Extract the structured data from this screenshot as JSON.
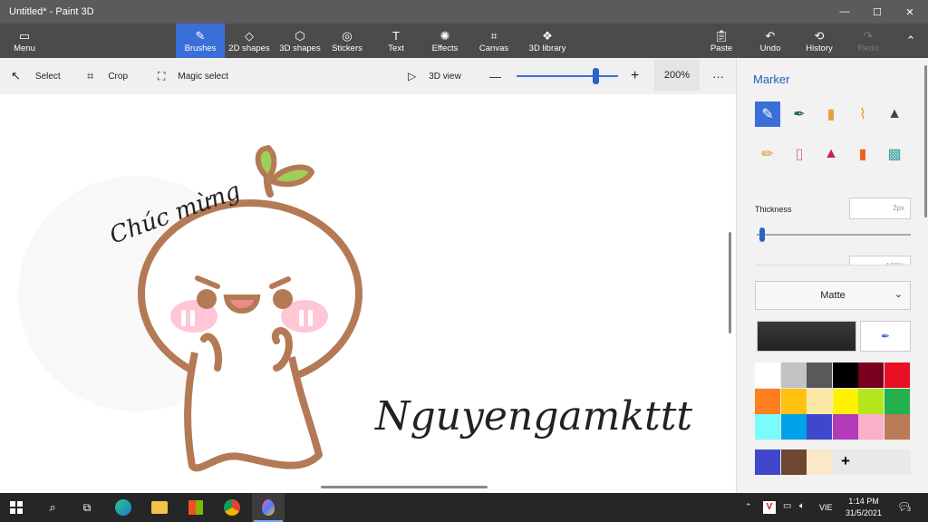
{
  "window": {
    "title": "Untitled* - Paint 3D",
    "min": "—",
    "max": "☐",
    "close": "✕"
  },
  "ribbon": {
    "menu": "Menu",
    "tools": [
      {
        "label": "Brushes",
        "icon": "✎"
      },
      {
        "label": "2D shapes",
        "icon": "◇"
      },
      {
        "label": "3D shapes",
        "icon": "⬡"
      },
      {
        "label": "Stickers",
        "icon": "◎"
      },
      {
        "label": "Text",
        "icon": "T"
      },
      {
        "label": "Effects",
        "icon": "✺"
      },
      {
        "label": "Canvas",
        "icon": "⌗"
      },
      {
        "label": "3D library",
        "icon": "❖"
      }
    ],
    "paste": "Paste",
    "undo": "Undo",
    "history": "History",
    "redo": "Redo"
  },
  "toolbar": {
    "select": "Select",
    "crop": "Crop",
    "magic_select": "Magic select",
    "view_3d": "3D view",
    "zoom_minus": "—",
    "zoom_plus": "+",
    "zoom": "200%",
    "more": "···",
    "zoom_level": 0.78
  },
  "canvas": {
    "text1": "Chúc mừng",
    "text2": "Nguyengamkttt"
  },
  "panel": {
    "title": "Marker",
    "brushes": [
      "marker-icon",
      "calligraphy-pen-icon",
      "oil-brush-icon",
      "watercolor-icon",
      "pen-icon",
      "pencil-icon",
      "eraser-icon",
      "crayon-icon",
      "spray-can-icon",
      "fill-bucket-icon"
    ],
    "thickness_label": "Thickness",
    "thickness_value": "2px",
    "thickness_level": 0.02,
    "opacity_value": "100%",
    "finish": "Matte",
    "current_color": "#222222",
    "palette": [
      "#ffffff",
      "#c3c3c3",
      "#595959",
      "#000000",
      "#7a0020",
      "#e81123",
      "#ff7f1f",
      "#ffc20e",
      "#fbe8a6",
      "#fff200",
      "#b5e61d",
      "#22b14c",
      "#7afcfc",
      "#00a2e8",
      "#3f48cc",
      "#b33ab8",
      "#fab0c8",
      "#b97a57"
    ],
    "custom": [
      "#3f48cc",
      "#6e4631",
      "#fbe8c8"
    ],
    "add": "+"
  },
  "taskbar": {
    "lang": "VIE",
    "time": "1:14 PM",
    "date": "31/5/2021",
    "notif_count": "3"
  }
}
